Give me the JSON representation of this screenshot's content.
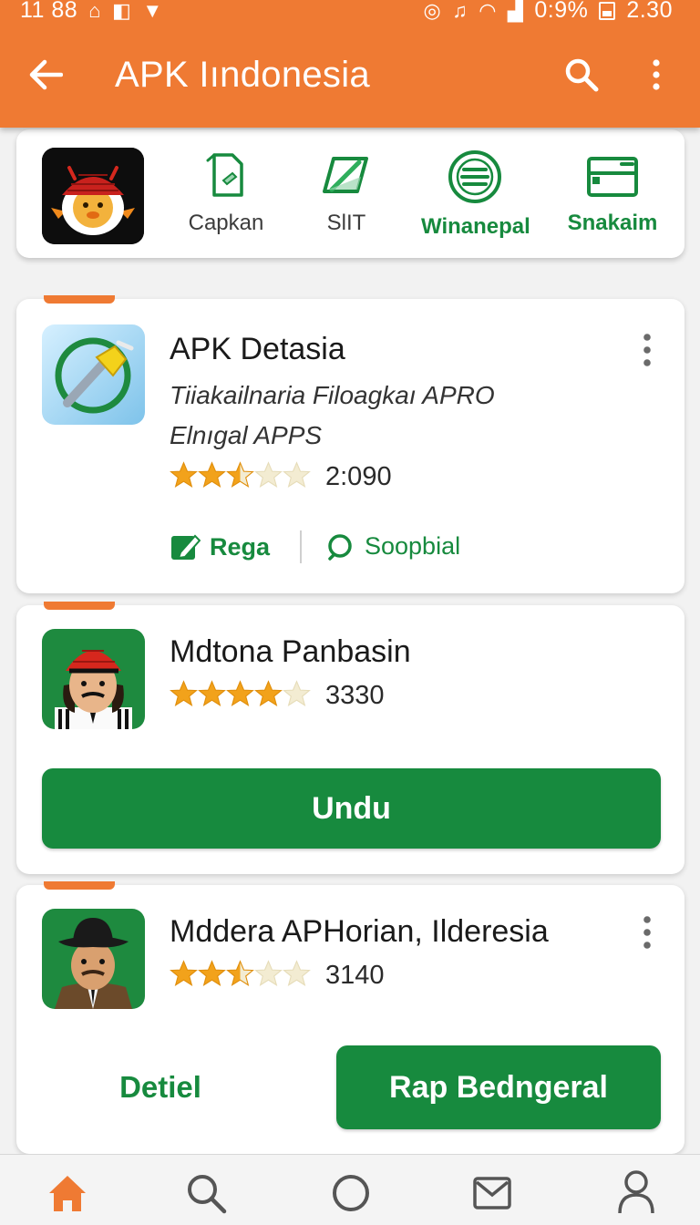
{
  "status_bar": {
    "time_left": "11 88",
    "battery_text": "0:9%",
    "clock": "2.30"
  },
  "header": {
    "title": "APK Iındonesia"
  },
  "categories": [
    {
      "label": "Capkan",
      "icon": "document-icon",
      "style": "gray"
    },
    {
      "label": "SlIT",
      "icon": "leaf-tag-icon",
      "style": "gray"
    },
    {
      "label": "Winanepal",
      "icon": "list-circle-icon",
      "style": "green"
    },
    {
      "label": "Snakaim",
      "icon": "wallet-icon",
      "style": "green"
    }
  ],
  "apps": [
    {
      "name": "APK Detasia",
      "subtitle_line1": "Tiiakailnaria Filoagkaı APRO",
      "subtitle_line2": "Elnıgal APPS",
      "rating": 2.5,
      "rating_count": "2:090",
      "actions": [
        {
          "label": "Rega",
          "icon": "edit-icon"
        },
        {
          "label": "Soopbial",
          "icon": "chat-bubble-icon"
        }
      ]
    },
    {
      "name": "Mdtona Panbasin",
      "rating": 4,
      "rating_count": "3330",
      "primary_button": "Undu"
    },
    {
      "name": "Mddera APHorian, Ilderesia",
      "rating": 2.5,
      "rating_count": "3140",
      "secondary_button": "Detiel",
      "primary_button": "Rap Bedngeral"
    }
  ],
  "bottom_nav": [
    {
      "icon": "home-icon",
      "active": true
    },
    {
      "icon": "search-icon",
      "active": false
    },
    {
      "icon": "circle-icon",
      "active": false
    },
    {
      "icon": "mail-icon",
      "active": false
    },
    {
      "icon": "profile-icon",
      "active": false
    }
  ],
  "colors": {
    "brand_orange": "#ef7a33",
    "accent_green": "#178a3e",
    "star_gold": "#f2a21b"
  }
}
